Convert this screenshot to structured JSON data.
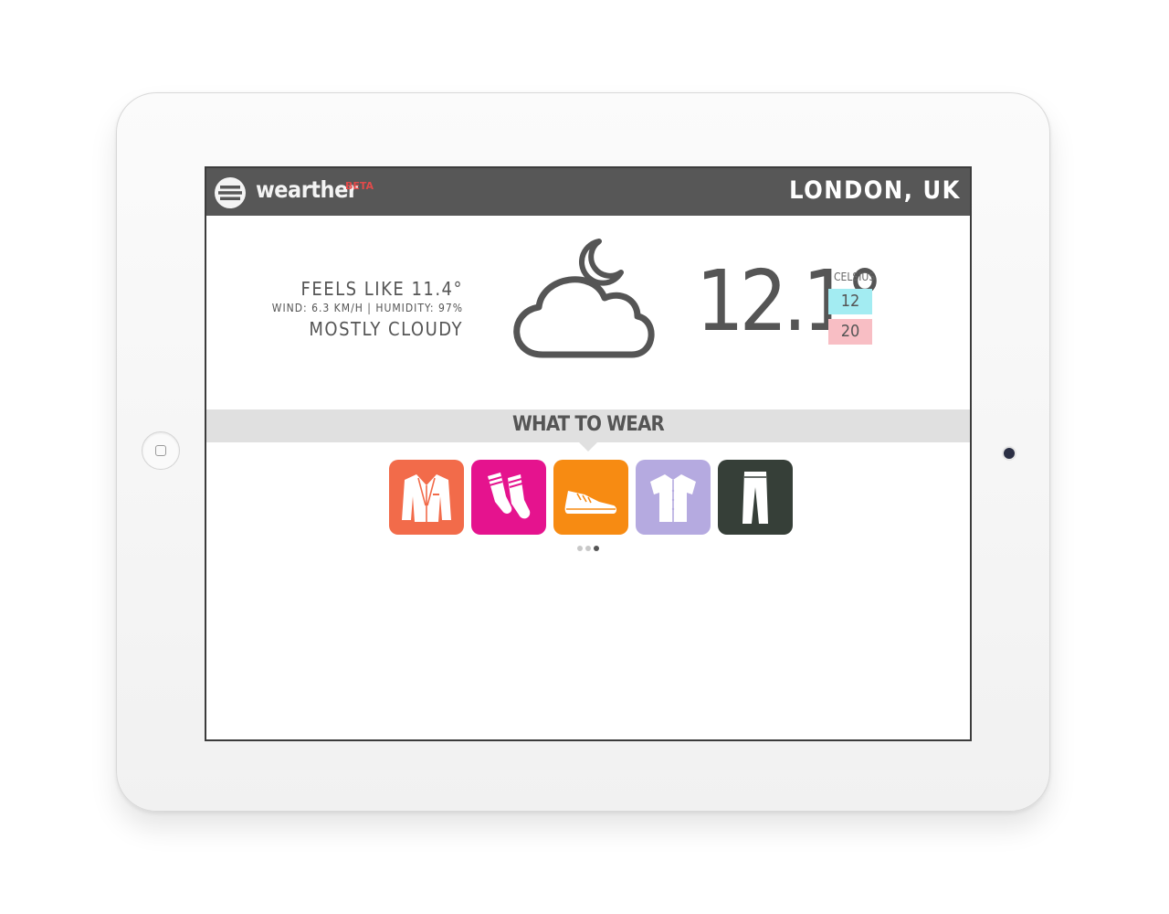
{
  "app": {
    "name": "wearther",
    "badge": "BETA",
    "location": "LONDON, UK"
  },
  "weather": {
    "feels_like": "FEELS LIKE 11.4°",
    "wind_humidity": "WIND: 6.3 KM/H | HUMIDITY: 97%",
    "condition": "MOSTLY CLOUDY",
    "condition_icon": "cloud-moon-icon",
    "temperature": "12.1°",
    "unit": "CELSIUS",
    "low": "12",
    "high": "20"
  },
  "wear": {
    "title": "WHAT TO WEAR",
    "items": [
      {
        "icon": "jacket-icon",
        "color": "#f26b4a"
      },
      {
        "icon": "socks-icon",
        "color": "#e5138e"
      },
      {
        "icon": "sneaker-icon",
        "color": "#f78b12"
      },
      {
        "icon": "shirt-icon",
        "color": "#b5aae0"
      },
      {
        "icon": "trousers-icon",
        "color": "#363f38"
      }
    ],
    "pages": 3,
    "active_page": 3
  },
  "colors": {
    "topbar": "#575757",
    "low_temp": "#a3ecf2",
    "high_temp": "#f8bec4",
    "beta": "#e24a4a"
  }
}
